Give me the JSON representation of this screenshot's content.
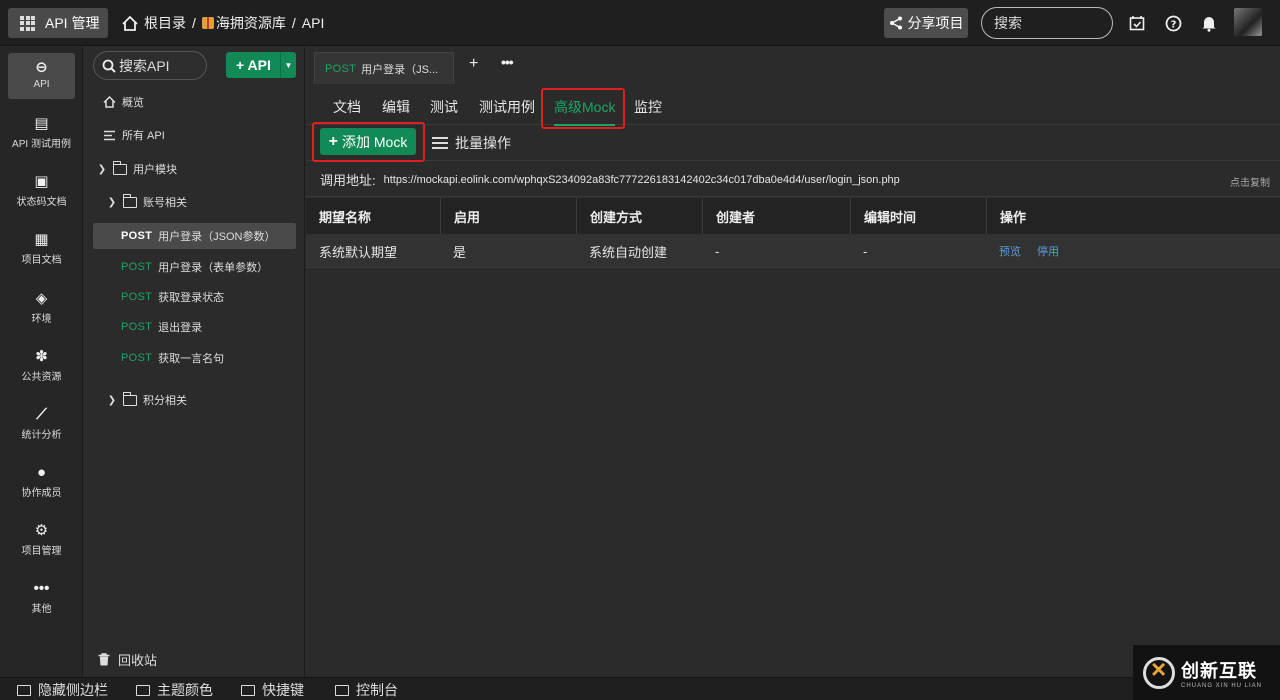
{
  "topbar": {
    "app_label": "API 管理",
    "breadcrumb": [
      "根目录",
      "/",
      "海拥资源库",
      "/",
      "API"
    ],
    "share_label": "分享项目",
    "search_placeholder": "搜索"
  },
  "leftnav": [
    {
      "label": "API",
      "icon": "link-icon",
      "glyph": "⊖",
      "active": true
    },
    {
      "label": "API 测试用例",
      "icon": "clipboard-icon",
      "glyph": "▤"
    },
    {
      "label": "状态码文档",
      "icon": "doc-icon",
      "glyph": "▣"
    },
    {
      "label": "项目文档",
      "icon": "book-icon",
      "glyph": "▦"
    },
    {
      "label": "环境",
      "icon": "cube-icon",
      "glyph": "◈"
    },
    {
      "label": "公共资源",
      "icon": "puzzle-icon",
      "glyph": "✽"
    },
    {
      "label": "统计分析",
      "icon": "chart-icon",
      "glyph": "⟋"
    },
    {
      "label": "协作成员",
      "icon": "user-icon",
      "glyph": "●"
    },
    {
      "label": "项目管理",
      "icon": "settings-icon",
      "glyph": "⚙"
    },
    {
      "label": "其他",
      "icon": "more-icon",
      "glyph": "•••"
    }
  ],
  "tree": {
    "search_placeholder": "搜索API",
    "add_label": "+ API",
    "overview": "概览",
    "all_api": "所有 API",
    "group_user": "用户模块",
    "group_account": "账号相关",
    "items": [
      {
        "method": "POST",
        "name": "用户登录（JSON参数）",
        "active": true
      },
      {
        "method": "POST",
        "name": "用户登录（表单参数）"
      },
      {
        "method": "POST",
        "name": "获取登录状态"
      },
      {
        "method": "POST",
        "name": "退出登录"
      },
      {
        "method": "POST",
        "name": "获取一言名句"
      }
    ],
    "group_points": "积分相关",
    "recycle": "回收站"
  },
  "main": {
    "doc_tab": {
      "method": "POST",
      "name": "用户登录（JS..."
    },
    "subtabs": [
      "文档",
      "编辑",
      "测试",
      "测试用例",
      "高级Mock",
      "监控"
    ],
    "active_subtab": "高级Mock",
    "add_mock_label": "添加 Mock",
    "batch_label": "批量操作",
    "url_label": "调用地址:",
    "url_value": "https://mockapi.eolink.com/wphqxS234092a83fc777226183142402c34c017dba0e4d4/user/login_json.php",
    "copy_label": "点击复制",
    "table_headers": [
      "期望名称",
      "启用",
      "创建方式",
      "创建者",
      "编辑时间",
      "操作"
    ],
    "rows": [
      {
        "name": "系统默认期望",
        "enabled": "是",
        "method": "系统自动创建",
        "creator": "-",
        "edited": "-",
        "actions": [
          "预览",
          "停用"
        ]
      }
    ]
  },
  "bottombar": [
    "隐藏侧边栏",
    "主题颜色",
    "快捷键",
    "控制台"
  ],
  "logo": {
    "cn": "创新互联",
    "en": "CHUANG XIN HU LIAN"
  },
  "colors": {
    "accent": "#118a55",
    "highlight_box": "#e02020",
    "link": "#5b9bd8"
  }
}
